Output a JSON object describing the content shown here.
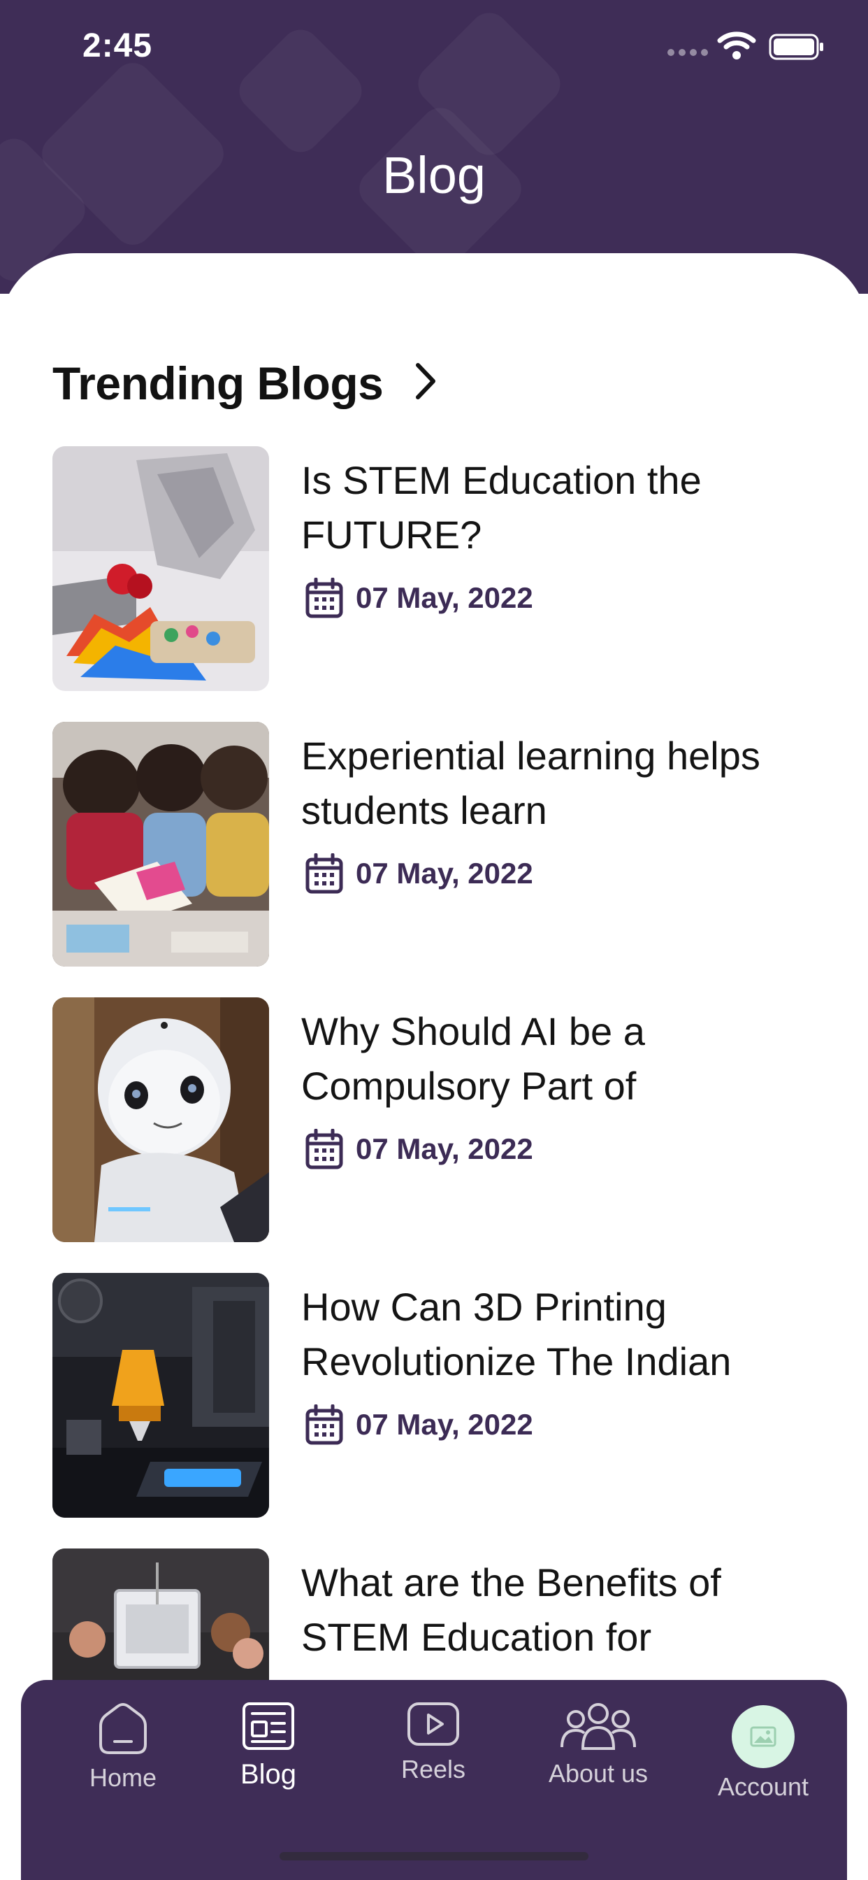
{
  "status_bar": {
    "time": "2:45"
  },
  "header": {
    "title": "Blog"
  },
  "section": {
    "title": "Trending Blogs"
  },
  "blogs": [
    {
      "title": "Is STEM Education the FUTURE?",
      "date": "07 May, 2022",
      "image": "3d-printer-models-photo"
    },
    {
      "title": "Experiential learning helps students learn",
      "date": "07 May, 2022",
      "image": "students-reading-photo"
    },
    {
      "title": "Why Should AI be a Compulsory Part of",
      "date": "07 May, 2022",
      "image": "robot-photo"
    },
    {
      "title": "How Can 3D Printing Revolutionize The Indian",
      "date": "07 May, 2022",
      "image": "3d-printing-nozzle-photo"
    },
    {
      "title": "What are the Benefits of STEM Education for",
      "date": "",
      "image": "kids-with-3d-printer-photo"
    }
  ],
  "tab_bar": {
    "tabs": [
      {
        "label": "Home",
        "icon": "home-icon"
      },
      {
        "label": "Blog",
        "icon": "blog-icon",
        "active": true
      },
      {
        "label": "Reels",
        "icon": "play-icon"
      },
      {
        "label": "About us",
        "icon": "group-icon"
      },
      {
        "label": "Account",
        "icon": "avatar-image"
      }
    ]
  },
  "colors": {
    "primary": "#3f2d57",
    "accent_text": "#3c2b55",
    "avatar_bg": "#d8f5e4"
  }
}
